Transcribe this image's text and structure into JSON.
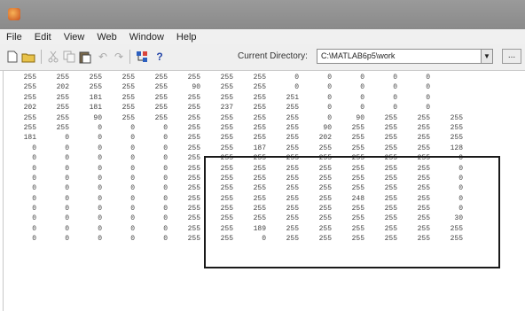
{
  "menu": [
    "File",
    "Edit",
    "View",
    "Web",
    "Window",
    "Help"
  ],
  "toolbar": {
    "icons": [
      "new-file-icon",
      "open-folder-icon",
      "cut-icon",
      "copy-icon",
      "paste-icon",
      "undo-icon",
      "redo-icon",
      "simulink-icon",
      "help-icon"
    ],
    "current_directory_label": "Current Directory:",
    "current_directory_value": "C:\\MATLAB6p5\\work",
    "dropdown_glyph": "▼",
    "browse_label": "..."
  },
  "matrix": [
    [
      "255",
      "255",
      "255",
      "255",
      "255",
      "255",
      "255",
      "255",
      "0",
      "0",
      "0",
      "0",
      "0",
      ""
    ],
    [
      "255",
      "202",
      "255",
      "255",
      "255",
      "90",
      "255",
      "255",
      "0",
      "0",
      "0",
      "0",
      "0",
      ""
    ],
    [
      "255",
      "255",
      "181",
      "255",
      "255",
      "255",
      "255",
      "255",
      "251",
      "0",
      "0",
      "0",
      "0",
      ""
    ],
    [
      "202",
      "255",
      "181",
      "255",
      "255",
      "255",
      "237",
      "255",
      "255",
      "0",
      "0",
      "0",
      "0",
      ""
    ],
    [
      "255",
      "255",
      "90",
      "255",
      "255",
      "255",
      "255",
      "255",
      "255",
      "0",
      "90",
      "255",
      "255",
      "255"
    ],
    [
      "255",
      "255",
      "0",
      "0",
      "0",
      "255",
      "255",
      "255",
      "255",
      "90",
      "255",
      "255",
      "255",
      "255"
    ],
    [
      "181",
      "0",
      "0",
      "0",
      "0",
      "255",
      "255",
      "255",
      "255",
      "202",
      "255",
      "255",
      "255",
      "255"
    ],
    [
      "0",
      "0",
      "0",
      "0",
      "0",
      "255",
      "255",
      "187",
      "255",
      "255",
      "255",
      "255",
      "255",
      "128"
    ],
    [
      "0",
      "0",
      "0",
      "0",
      "0",
      "255",
      "255",
      "255",
      "255",
      "255",
      "255",
      "255",
      "255",
      "0"
    ],
    [
      "0",
      "0",
      "0",
      "0",
      "0",
      "255",
      "255",
      "255",
      "255",
      "255",
      "255",
      "255",
      "255",
      "0"
    ],
    [
      "0",
      "0",
      "0",
      "0",
      "0",
      "255",
      "255",
      "255",
      "255",
      "255",
      "255",
      "255",
      "255",
      "0"
    ],
    [
      "0",
      "0",
      "0",
      "0",
      "0",
      "255",
      "255",
      "255",
      "255",
      "255",
      "255",
      "255",
      "255",
      "0"
    ],
    [
      "0",
      "0",
      "0",
      "0",
      "0",
      "255",
      "255",
      "255",
      "255",
      "255",
      "248",
      "255",
      "255",
      "0"
    ],
    [
      "0",
      "0",
      "0",
      "0",
      "0",
      "255",
      "255",
      "255",
      "255",
      "255",
      "255",
      "255",
      "255",
      "0"
    ],
    [
      "0",
      "0",
      "0",
      "0",
      "0",
      "255",
      "255",
      "255",
      "255",
      "255",
      "255",
      "255",
      "255",
      "30"
    ],
    [
      "0",
      "0",
      "0",
      "0",
      "0",
      "255",
      "255",
      "189",
      "255",
      "255",
      "255",
      "255",
      "255",
      "255"
    ],
    [
      "0",
      "0",
      "0",
      "0",
      "0",
      "255",
      "255",
      "0",
      "255",
      "255",
      "255",
      "255",
      "255",
      "255"
    ]
  ]
}
